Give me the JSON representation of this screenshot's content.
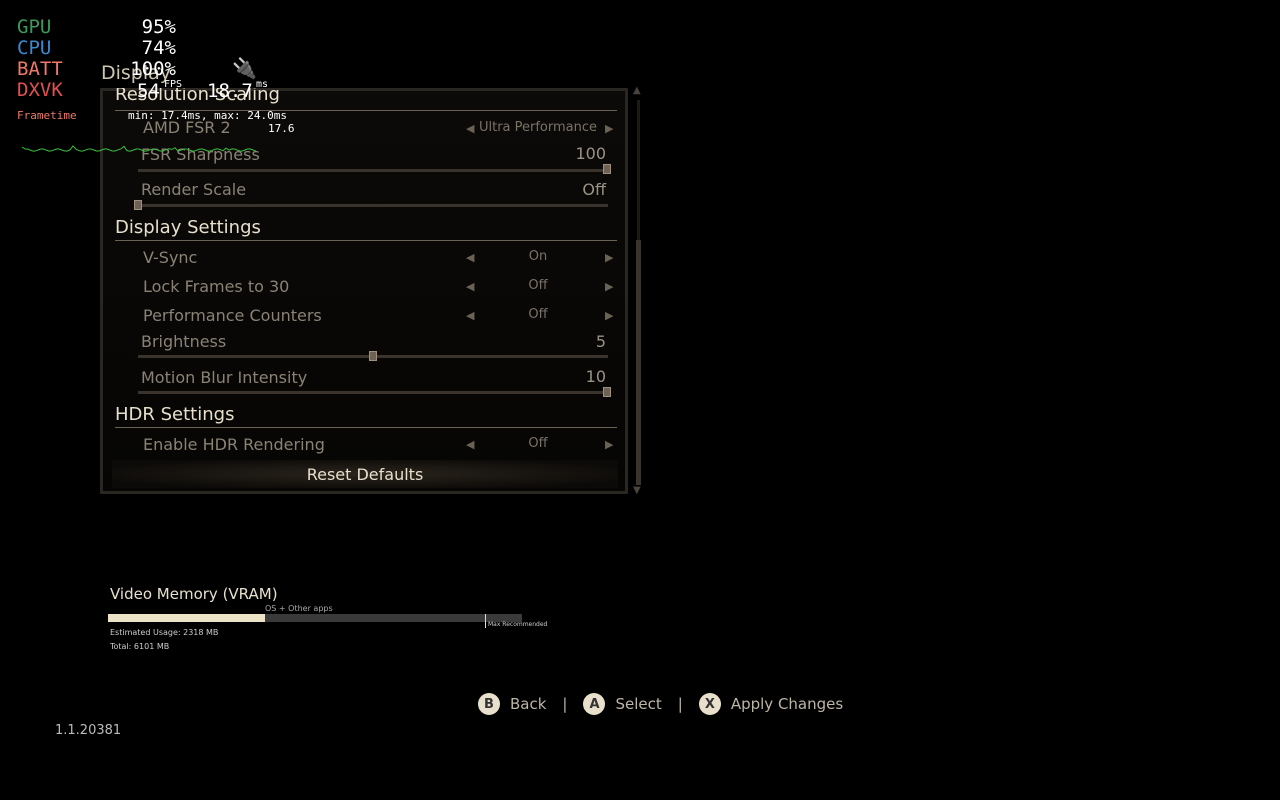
{
  "panel": {
    "title": "Display",
    "sections": [
      {
        "title": "Resolution Scaling"
      },
      {
        "title": "Display Settings"
      },
      {
        "title": "HDR Settings"
      }
    ],
    "rows": {
      "fsr": {
        "label": "AMD FSR 2",
        "value": "Ultra Performance"
      },
      "sharp": {
        "label": "FSR Sharpness",
        "value": "100",
        "fraction": 1.0
      },
      "render": {
        "label": "Render Scale",
        "value": "Off",
        "fraction": 0.0
      },
      "vsync": {
        "label": "V-Sync",
        "value": "On"
      },
      "lock": {
        "label": "Lock Frames to 30",
        "value": "Off"
      },
      "perf": {
        "label": "Performance Counters",
        "value": "Off"
      },
      "bright": {
        "label": "Brightness",
        "value": "5",
        "fraction": 0.5
      },
      "blur": {
        "label": "Motion Blur Intensity",
        "value": "10",
        "fraction": 1.0
      },
      "hdr": {
        "label": "Enable HDR Rendering",
        "value": "Off"
      }
    },
    "reset": "Reset Defaults"
  },
  "vram": {
    "title": "Video Memory (VRAM)",
    "os_label": "OS + Other apps",
    "max_label": "Max Recommended",
    "usage": "Estimated Usage: 2318 MB",
    "total": "Total: 6101 MB",
    "used_fraction": 0.38,
    "max_fraction": 0.91
  },
  "footer": {
    "back": "Back",
    "select": "Select",
    "apply": "Apply Changes",
    "b": "B",
    "a": "A",
    "x": "X",
    "sep": "|"
  },
  "version": "1.1.20381",
  "overlay": {
    "gpu_label": "GPU",
    "gpu": "95%",
    "cpu_label": "CPU",
    "cpu": "74%",
    "batt_label": "BATT",
    "batt": "100%",
    "dxvk_label": "DXVK",
    "fps": "54",
    "fps_unit": "FPS",
    "frametime": "18.7",
    "ms_unit": "ms",
    "ft_label": "Frametime",
    "minmax": "min: 17.4ms, max: 24.0ms",
    "current": "17.6",
    "colors": {
      "gpu": "#3a9a5a",
      "cpu": "#3a8ad0",
      "batt": "#f07868",
      "dxvk": "#e05050"
    }
  }
}
